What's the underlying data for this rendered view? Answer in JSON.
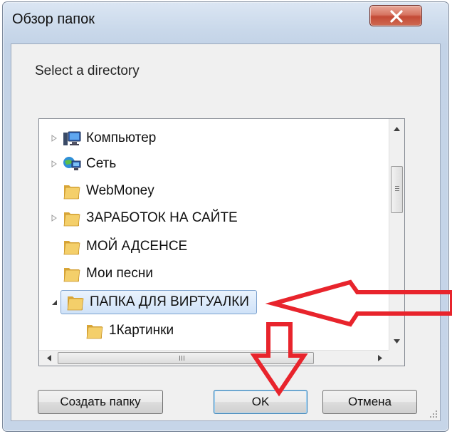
{
  "window": {
    "title": "Обзор папок"
  },
  "dialog": {
    "prompt": "Select a directory"
  },
  "tree": {
    "items": [
      {
        "label": "Компьютер",
        "icon": "computer-icon",
        "expander": "collapsed"
      },
      {
        "label": "Сеть",
        "icon": "network-icon",
        "expander": "collapsed"
      },
      {
        "label": "WebMoney",
        "icon": "folder-icon",
        "expander": "none"
      },
      {
        "label": "ЗАРАБОТОК НА САЙТЕ",
        "icon": "folder-icon",
        "expander": "collapsed"
      },
      {
        "label": "МОЙ АДСЕНСЕ",
        "icon": "folder-icon",
        "expander": "none"
      },
      {
        "label": "Мои песни",
        "icon": "folder-icon",
        "expander": "none"
      },
      {
        "label": "ПАПКА ДЛЯ ВИРТУАЛКИ",
        "icon": "folder-icon",
        "expander": "expanded",
        "selected": true
      },
      {
        "label": "1Картинки",
        "icon": "folder-icon",
        "expander": "none",
        "child": true
      }
    ]
  },
  "buttons": {
    "new_folder": "Создать папку",
    "ok": "OK",
    "cancel": "Отмена"
  },
  "colors": {
    "annotation_arrow": "#e8242c",
    "selection": "#cfe2f8",
    "close_button": "#c44a35"
  }
}
